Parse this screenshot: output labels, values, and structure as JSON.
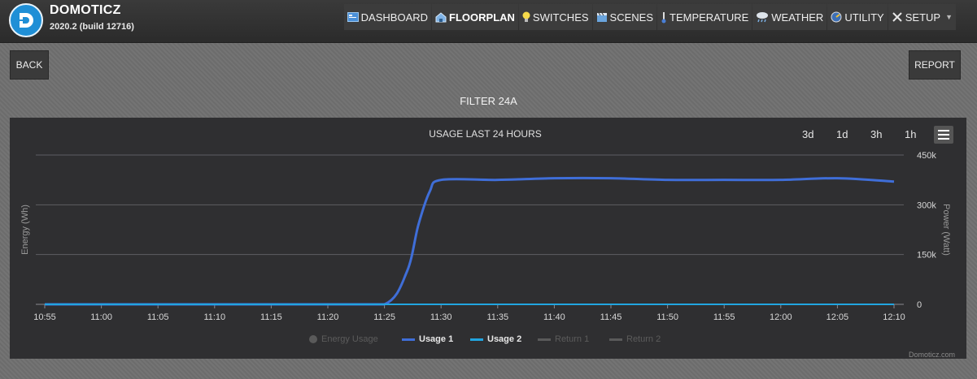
{
  "header": {
    "brand": "DOMOTICZ",
    "version": "2020.2 (build 12716)",
    "nav": [
      {
        "label": "DASHBOARD",
        "icon": "dashboard-icon",
        "active": false
      },
      {
        "label": "FLOORPLAN",
        "icon": "house-icon",
        "active": true
      },
      {
        "label": "SWITCHES",
        "icon": "lightbulb-icon",
        "active": false
      },
      {
        "label": "SCENES",
        "icon": "clapperboard-icon",
        "active": false
      },
      {
        "label": "TEMPERATURE",
        "icon": "thermometer-icon",
        "active": false
      },
      {
        "label": "WEATHER",
        "icon": "cloud-rain-icon",
        "active": false
      },
      {
        "label": "UTILITY",
        "icon": "meter-icon",
        "active": false
      },
      {
        "label": "SETUP",
        "icon": "tools-icon",
        "active": false
      }
    ]
  },
  "buttons": {
    "back": "BACK",
    "report": "REPORT"
  },
  "device_title": "FILTER 24A",
  "ranges": [
    "3d",
    "1d",
    "3h",
    "1h"
  ],
  "credit": "Domoticz.com",
  "colors": {
    "usage1": "#3f6ed8",
    "usage2": "#21a5e0",
    "disabled": "#5a5a5a",
    "grid": "#5e5e62"
  },
  "chart_data": {
    "type": "line",
    "title": "USAGE LAST 24 HOURS",
    "x_ticks": [
      "10:55",
      "11:00",
      "11:05",
      "11:10",
      "11:15",
      "11:20",
      "11:25",
      "11:30",
      "11:35",
      "11:40",
      "11:45",
      "11:50",
      "11:55",
      "12:00",
      "12:05",
      "12:10"
    ],
    "y_left": {
      "label": "Energy (Wh)"
    },
    "y_right": {
      "label": "Power (Watt)",
      "ticks": [
        "0",
        "150k",
        "300k",
        "450k"
      ],
      "range": [
        0,
        450000
      ]
    },
    "grid": true,
    "legend_position": "bottom",
    "series": [
      {
        "name": "Energy Usage",
        "visible": false,
        "axis": "left",
        "x": [],
        "y": []
      },
      {
        "name": "Usage 1",
        "visible": true,
        "axis": "right",
        "x": [
          "10:55",
          "11:00",
          "11:05",
          "11:10",
          "11:15",
          "11:20",
          "11:25",
          "11:27",
          "11:28",
          "11:29",
          "11:30",
          "11:35",
          "11:40",
          "11:45",
          "11:50",
          "11:55",
          "12:00",
          "12:05",
          "12:10"
        ],
        "y": [
          0,
          0,
          0,
          0,
          0,
          0,
          0,
          100000,
          240000,
          340000,
          375000,
          375000,
          380000,
          380000,
          375000,
          375000,
          375000,
          380000,
          370000
        ]
      },
      {
        "name": "Usage 2",
        "visible": true,
        "axis": "right",
        "x": [
          "10:55",
          "11:00",
          "11:05",
          "11:10",
          "11:15",
          "11:20",
          "11:25",
          "11:30",
          "11:35",
          "11:40",
          "11:45",
          "11:50",
          "11:55",
          "12:00",
          "12:05",
          "12:10"
        ],
        "y": [
          0,
          0,
          0,
          0,
          0,
          0,
          0,
          0,
          0,
          0,
          0,
          0,
          0,
          0,
          0,
          0
        ]
      },
      {
        "name": "Return 1",
        "visible": false,
        "axis": "right",
        "x": [],
        "y": []
      },
      {
        "name": "Return 2",
        "visible": false,
        "axis": "right",
        "x": [],
        "y": []
      }
    ]
  }
}
